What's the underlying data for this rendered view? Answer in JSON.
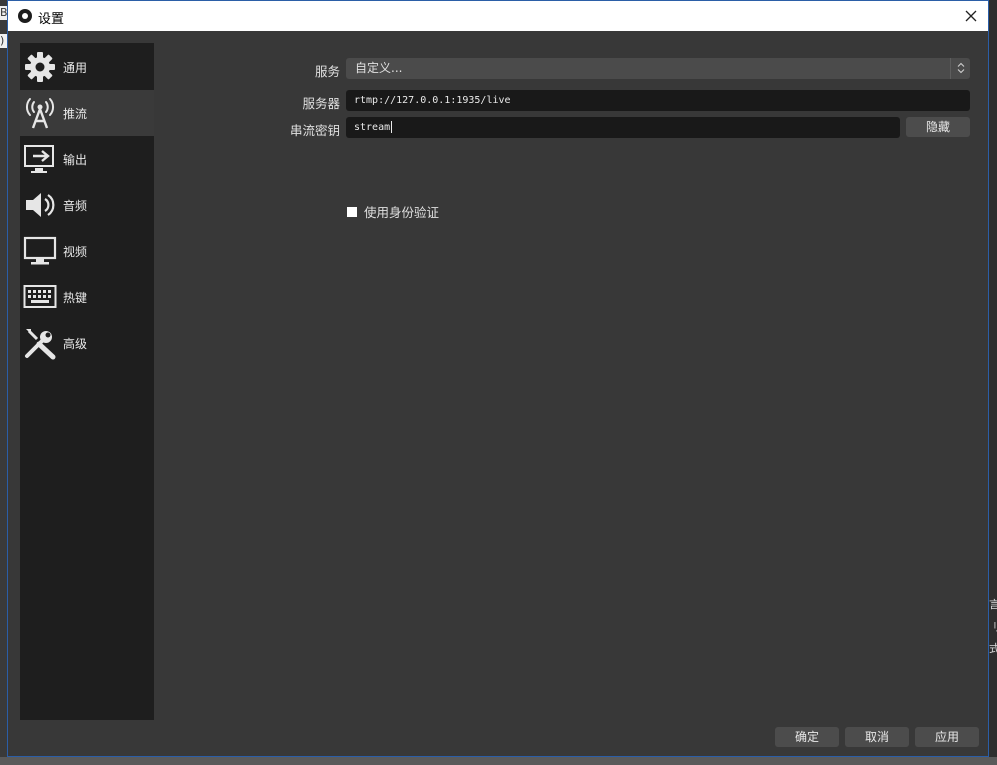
{
  "window": {
    "title": "设置"
  },
  "sidebar": {
    "items": [
      {
        "label": "通用",
        "icon": "gear-icon"
      },
      {
        "label": "推流",
        "icon": "broadcast-antenna-icon",
        "selected": true
      },
      {
        "label": "输出",
        "icon": "output-monitor-icon"
      },
      {
        "label": "音频",
        "icon": "speaker-icon"
      },
      {
        "label": "视频",
        "icon": "monitor-icon"
      },
      {
        "label": "热键",
        "icon": "keyboard-icon"
      },
      {
        "label": "高级",
        "icon": "tools-icon"
      }
    ]
  },
  "stream": {
    "service_label": "服务",
    "service_value": "自定义...",
    "server_label": "服务器",
    "server_value": "rtmp://127.0.0.1:1935/live",
    "key_label": "串流密钥",
    "key_value": "stream",
    "hide_button": "隐藏",
    "auth_label": "使用身份验证",
    "auth_checked": false
  },
  "footer": {
    "ok": "确定",
    "cancel": "取消",
    "apply": "应用"
  },
  "colors": {
    "dialog_bg": "#383838",
    "sidebar_bg": "#1e1e1e",
    "selected_bg": "#3a3a3a",
    "input_bg": "#191919",
    "button_bg": "#4c4c4c"
  }
}
